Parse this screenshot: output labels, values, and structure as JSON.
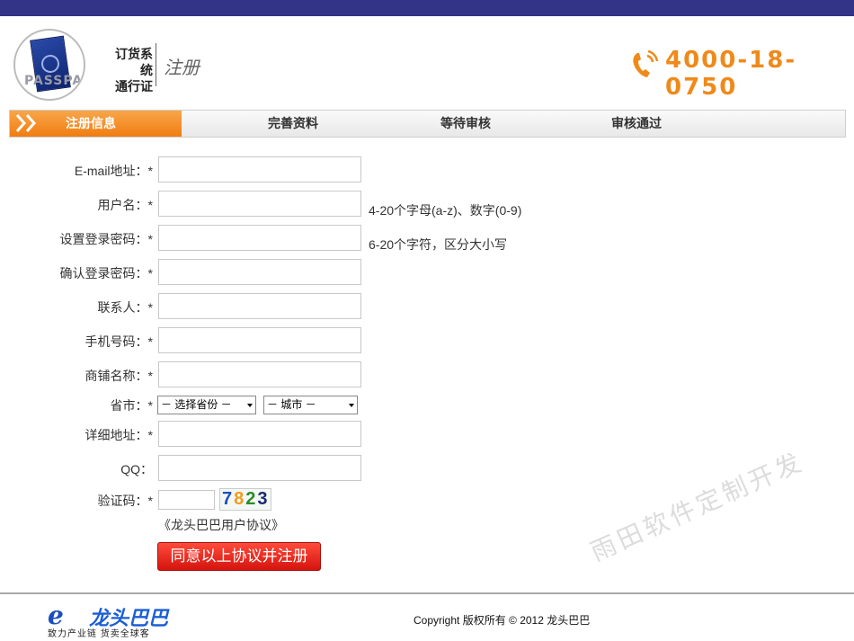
{
  "header": {
    "logo_word": "PASSPART",
    "brand_line1": "订货系统",
    "brand_line2": "通行证",
    "page_name": "注册",
    "phone": "4000-18-0750"
  },
  "steps": [
    {
      "label": "注册信息",
      "active": true
    },
    {
      "label": "完善资料",
      "active": false
    },
    {
      "label": "等待审核",
      "active": false
    },
    {
      "label": "审核通过",
      "active": false
    }
  ],
  "form": {
    "email_label": "E-mail地址：*",
    "username_label": "用户名：*",
    "username_hint": "4-20个字母(a-z)、数字(0-9)",
    "password_label": "设置登录密码：*",
    "password_hint": "6-20个字符，区分大小写",
    "confirm_label": "确认登录密码：*",
    "contact_label": "联系人：*",
    "mobile_label": "手机号码：*",
    "shop_label": "商铺名称：*",
    "region_label": "省市：*",
    "province_selected": "－ 选择省份 －",
    "city_selected": "－ 城市 －",
    "address_label": "详细地址：*",
    "qq_label": "QQ：",
    "captcha_label": "验证码：*",
    "captcha_chars": [
      "7",
      "8",
      "2",
      "3"
    ],
    "agreement_link": "《龙头巴巴用户协议》",
    "submit_label": "同意以上协议并注册"
  },
  "watermark": "雨田软件定制开发",
  "footer": {
    "logo_e": "e",
    "logo_name": "龙头巴巴",
    "logo_slogan": "致力产业链  货卖全球客",
    "copyright": "Copyright 版权所有 © 2012 龙头巴巴"
  },
  "colors": {
    "topbar": "#333388",
    "accent_orange": "#ef8a1a",
    "button_red": "#d4140f"
  }
}
